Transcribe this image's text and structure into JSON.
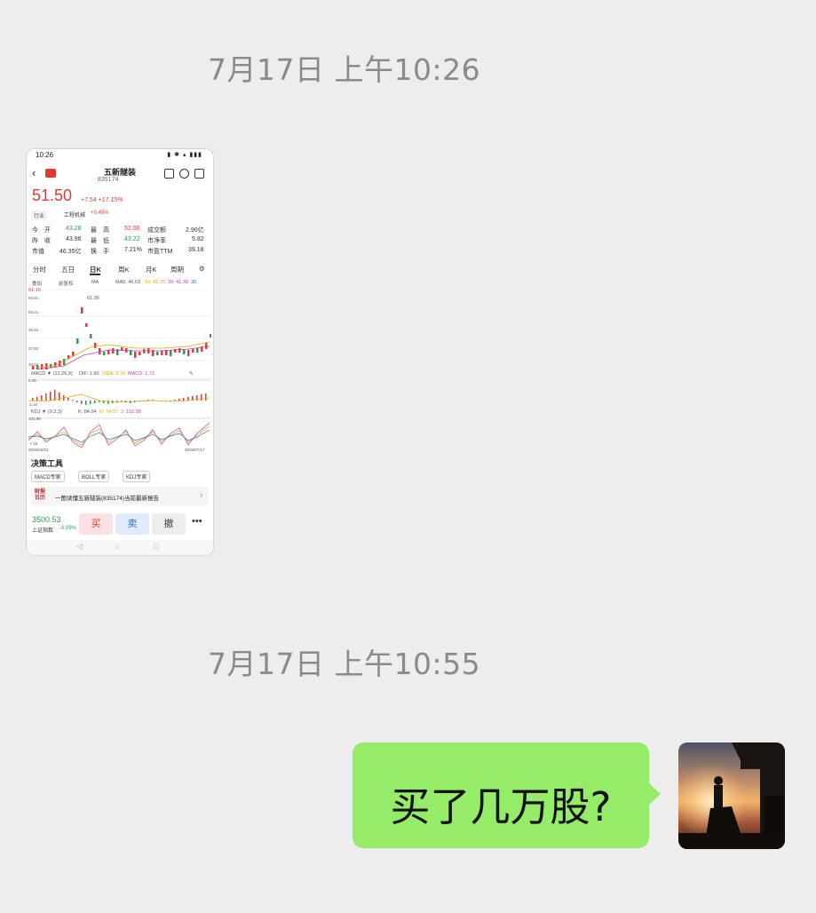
{
  "chat": {
    "timestamps": [
      "7月17日 上午10:26",
      "7月17日 上午10:55"
    ],
    "message_text": "买了几万股?"
  },
  "screenshot": {
    "status_time": "10:26",
    "stock_name": "五新隧装",
    "stock_code": "835174",
    "price": "51.50",
    "change": "+7.54",
    "change_pct": "+17.15%",
    "industry_tag": "行业",
    "industry_name": "工程机械",
    "industry_change": "+0.45%",
    "quote": {
      "row1": [
        "今　开",
        "43.28",
        "最　高",
        "52.00",
        "成交额",
        "2.90亿"
      ],
      "row2": [
        "昨　收",
        "43.96",
        "最　低",
        "43.22",
        "市净率",
        "5.82"
      ],
      "row3": [
        "市值",
        "46.35亿",
        "换　手",
        "7.21%",
        "市盈TTM",
        "39.18"
      ]
    },
    "tabs": [
      "分时",
      "五日",
      "日K",
      "周K",
      "月K",
      "周期"
    ],
    "controls": [
      "叠加",
      "前复权",
      "MA",
      "MA5: 46.63",
      "10: 42.75",
      "20: 41.30",
      "30"
    ],
    "kline_labels": [
      "61.16",
      "62.51",
      "54.21",
      "45.91",
      "37.82",
      "29.52"
    ],
    "kline_peak": "61.36",
    "macd_label": "MACD ▼ (12,26,9)",
    "macd_values": [
      "DIF: 1.60",
      "DEA: 0.75",
      "MACD: 1.71"
    ],
    "macd_axis": [
      "5.46",
      "-1.44"
    ],
    "kdj_label": "KDJ ▼ (9,3,3)",
    "kdj_values": [
      "K: 84.04",
      "D: 74.57",
      "J: 102.98"
    ],
    "kdj_axis": [
      "102.98",
      "-7.16"
    ],
    "date_start": "2025/04/21",
    "date_end": "2025/07/17",
    "section_title": "决策工具",
    "tools": [
      "MACD专家",
      "BOLL专家",
      "KDJ专家"
    ],
    "news_badge": "财报 日历",
    "news_text": "一图读懂五新隧装(835174)当前最新报告",
    "index_value": "3500.53",
    "index_name": "上证指数",
    "index_change": "-0.09%",
    "buttons": {
      "buy": "买",
      "sell": "卖",
      "cancel": "撤",
      "more": "•••"
    }
  }
}
